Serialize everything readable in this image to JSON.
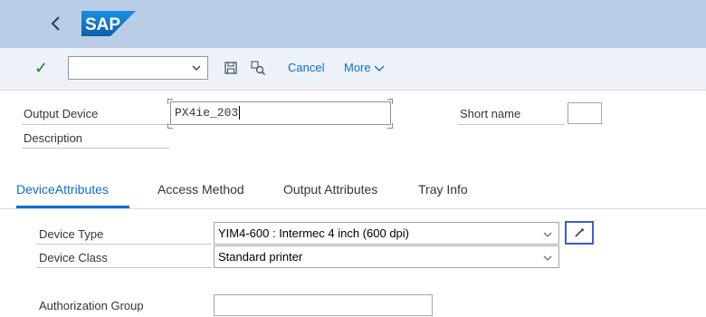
{
  "shell": {
    "logo_text": "SAP"
  },
  "toolbar": {
    "command_value": "",
    "cancel_label": "Cancel",
    "more_label": "More"
  },
  "form": {
    "output_device_label": "Output Device",
    "output_device_value": "PX4ie_203",
    "short_name_label": "Short name",
    "short_name_value": "",
    "description_label": "Description"
  },
  "tabs": [
    {
      "label": "DeviceAttributes",
      "active": true
    },
    {
      "label": "Access Method",
      "active": false
    },
    {
      "label": "Output Attributes",
      "active": false
    },
    {
      "label": "Tray Info",
      "active": false
    }
  ],
  "attributes": {
    "device_type_label": "Device Type",
    "device_type_value": "YIM4-600 : Intermec 4 inch (600 dpi)",
    "device_class_label": "Device Class",
    "device_class_value": "Standard printer",
    "auth_group_label": "Authorization Group",
    "auth_group_value": ""
  },
  "colors": {
    "shell": "#b9cee6",
    "toolbar": "#edf2f8",
    "accent": "#0a6ed1",
    "focus_border": "#3f5ad2",
    "check": "#2b7c2b"
  }
}
